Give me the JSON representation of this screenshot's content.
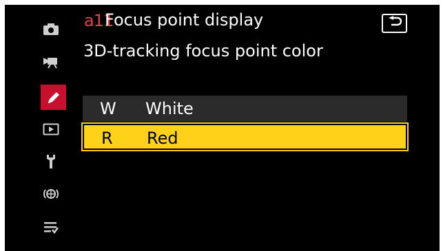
{
  "header": {
    "code": "a11",
    "title": "Focus point display",
    "back_icon": "return-arrow-icon"
  },
  "subtitle": "3D-tracking focus point color",
  "options": [
    {
      "key": "W",
      "label": "White",
      "selected": false
    },
    {
      "key": "R",
      "label": "Red",
      "selected": true
    }
  ],
  "sidebar": {
    "items": [
      {
        "icon": "camera-icon",
        "active": false
      },
      {
        "icon": "movie-camera-icon",
        "active": false
      },
      {
        "icon": "pencil-icon",
        "active": true
      },
      {
        "icon": "playback-icon",
        "active": false
      },
      {
        "icon": "wrench-icon",
        "active": false
      },
      {
        "icon": "network-icon",
        "active": false
      },
      {
        "icon": "my-menu-icon",
        "active": false
      }
    ]
  },
  "colors": {
    "background": "#000000",
    "accent_red": "#c8102e",
    "highlight_yellow": "#ffd21a",
    "row_gray": "#2a2a2a",
    "code_red": "#e8404a"
  }
}
